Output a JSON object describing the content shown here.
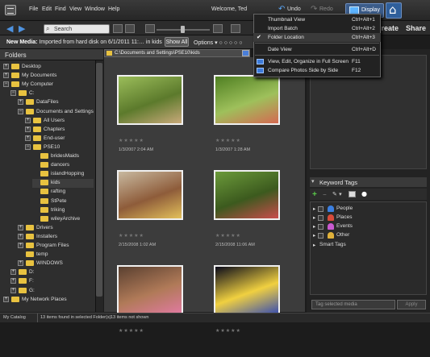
{
  "menubar": {
    "items": [
      "File",
      "Edit",
      "Find",
      "View",
      "Window",
      "Help"
    ],
    "welcome": "Welcome, Ted",
    "undo": "Undo",
    "redo": "Redo",
    "display": "Display"
  },
  "toolbar": {
    "search_placeholder": "Search",
    "create": "Create",
    "share": "Share"
  },
  "media_bar": {
    "prefix": "New Media:",
    "text": "Imported from hard disk on 6/1/2011 11:…",
    "in_kids": "in kids",
    "show_all": "Show All",
    "options": "Options"
  },
  "folders": {
    "title": "Folders",
    "tree": [
      {
        "label": "Desktop",
        "depth": 0,
        "expander": "+"
      },
      {
        "label": "My Documents",
        "depth": 0,
        "expander": "+"
      },
      {
        "label": "My Computer",
        "depth": 0,
        "expander": "−"
      },
      {
        "label": "C:",
        "depth": 1,
        "expander": "−"
      },
      {
        "label": "DataFiles",
        "depth": 2,
        "expander": "+"
      },
      {
        "label": "Documents and Settings",
        "depth": 2,
        "expander": "−"
      },
      {
        "label": "All Users",
        "depth": 3,
        "expander": "+"
      },
      {
        "label": "Chapters",
        "depth": 3,
        "expander": "+"
      },
      {
        "label": "End-user",
        "depth": 3,
        "expander": "+"
      },
      {
        "label": "PSE10",
        "depth": 3,
        "expander": "−"
      },
      {
        "label": "bridesMaids",
        "depth": 4,
        "expander": ""
      },
      {
        "label": "dancers",
        "depth": 4,
        "expander": ""
      },
      {
        "label": "islandHopping",
        "depth": 4,
        "expander": ""
      },
      {
        "label": "kids",
        "depth": 4,
        "expander": "",
        "selected": true
      },
      {
        "label": "rafting",
        "depth": 4,
        "expander": ""
      },
      {
        "label": "StPete",
        "depth": 4,
        "expander": ""
      },
      {
        "label": "triking",
        "depth": 4,
        "expander": ""
      },
      {
        "label": "wileyArchive",
        "depth": 4,
        "expander": ""
      },
      {
        "label": "Drivers",
        "depth": 2,
        "expander": "+"
      },
      {
        "label": "Installers",
        "depth": 2,
        "expander": "+"
      },
      {
        "label": "Program Files",
        "depth": 2,
        "expander": "+"
      },
      {
        "label": "temp",
        "depth": 2,
        "expander": ""
      },
      {
        "label": "WINDOWS",
        "depth": 2,
        "expander": "+"
      },
      {
        "label": "D:",
        "depth": 1,
        "expander": "+"
      },
      {
        "label": "F:",
        "depth": 1,
        "expander": "+"
      },
      {
        "label": "G:",
        "depth": 1,
        "expander": "+"
      },
      {
        "label": "My Network Places",
        "depth": 0,
        "expander": "+"
      }
    ]
  },
  "grid": {
    "path": "C:\\Documents and Settings\\PSE10\\kids",
    "photos": [
      {
        "date": "1/3/2007 2:04 AM",
        "colors": [
          "#9bbd5a",
          "#5c7a2c",
          "#c9a97a"
        ]
      },
      {
        "date": "1/3/2007 1:28 AM",
        "colors": [
          "#4f7f22",
          "#9ec05b",
          "#d46a52"
        ]
      },
      {
        "date": "2/15/2008 1:02 AM",
        "colors": [
          "#c8b9a0",
          "#8e5c3a",
          "#e3c05a"
        ]
      },
      {
        "date": "2/15/2008 11:06 AM",
        "colors": [
          "#6b9a3a",
          "#3c5a1e",
          "#c94c4c"
        ]
      },
      {
        "date": "",
        "colors": [
          "#5a4030",
          "#b07a58",
          "#e07aa0"
        ]
      },
      {
        "date": "",
        "colors": [
          "#0a0a1a",
          "#f0d040",
          "#3a4fb0"
        ]
      }
    ]
  },
  "keywords": {
    "title": "Keyword Tags",
    "tags": [
      {
        "label": "People",
        "color": "#3b7fe0"
      },
      {
        "label": "Places",
        "color": "#d84b3a"
      },
      {
        "label": "Events",
        "color": "#c95ad0"
      },
      {
        "label": "Other",
        "color": "#e0b13a"
      }
    ],
    "smart_tags": "Smart Tags",
    "input_placeholder": "Tag selected media",
    "apply": "Apply"
  },
  "statusbar": {
    "catalog": "My Catalog",
    "count": "13 items found in selected Folder(s)",
    "not_shown": "13 items not shown"
  },
  "display_menu": [
    {
      "label": "Thumbnail View",
      "shortcut": "Ctrl+Alt+1"
    },
    {
      "label": "Import Batch",
      "shortcut": "Ctrl+Alt+2"
    },
    {
      "label": "Folder Location",
      "shortcut": "Ctrl+Alt+3",
      "checked": true
    },
    {
      "label": "Date View",
      "shortcut": "Ctrl+Alt+D"
    },
    {
      "label": "View, Edit, Organize in Full Screen",
      "shortcut": "F11"
    },
    {
      "label": "Compare Photos Side by Side",
      "shortcut": "F12"
    }
  ]
}
